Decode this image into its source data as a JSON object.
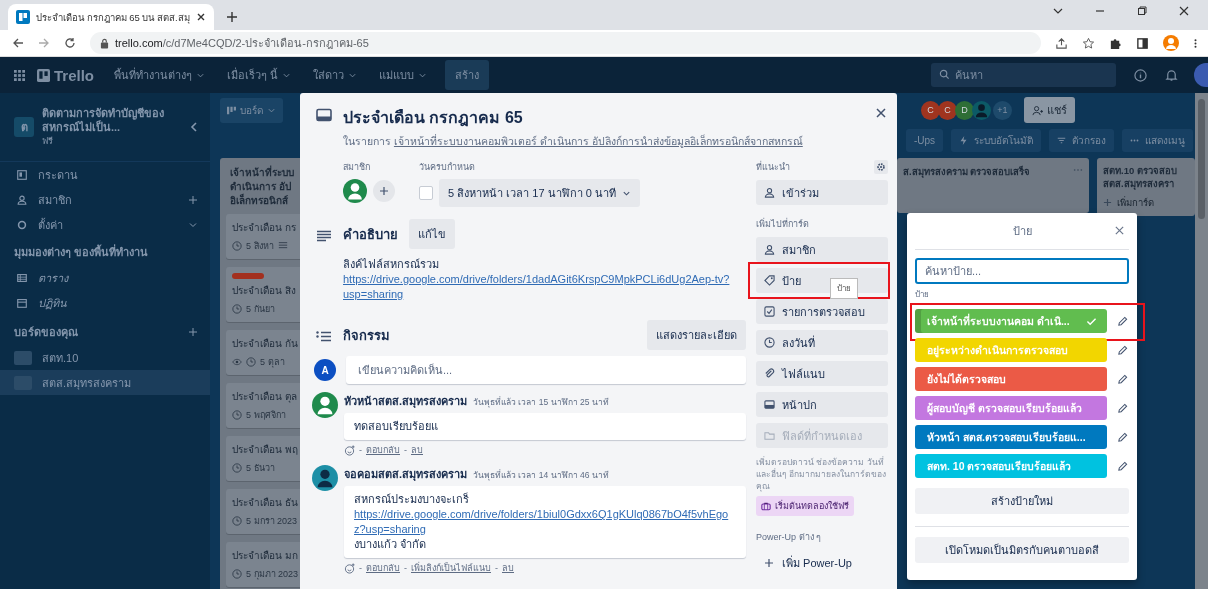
{
  "browser": {
    "tab_title": "ประจำเดือน กรกฎาคม 65 บน สตส.สมุ",
    "url_host": "trello.com",
    "url_path": "/c/d7Me4CQD/2-ประจำเดือน-กรกฎาคม-65"
  },
  "header": {
    "logo": "Trello",
    "menus": [
      "พื้นที่ทำงานต่างๆ",
      "เมื่อเร็วๆ นี้",
      "ใส่ดาว",
      "แม่แบบ"
    ],
    "create": "สร้าง",
    "search_placeholder": "ค้นหา"
  },
  "sidebar": {
    "workspace_letter": "ต",
    "workspace_name": "ติดตามการจัดทำบัญชีของสหกรณ์ไม่เป็น...",
    "plan": "ฟรี",
    "items": [
      "กระดาน",
      "สมาชิก",
      "ตั้งค่า"
    ],
    "views_heading": "มุมมองต่างๆ ของพื้นที่ทำงาน",
    "views": [
      "ตาราง",
      "ปฏิทิน"
    ],
    "boards_heading": "บอร์ดของคุณ",
    "boards": [
      {
        "name": "สตท.10",
        "selected": false
      },
      {
        "name": "สตส.สมุทรสงคราม",
        "selected": true
      }
    ]
  },
  "board": {
    "view_button": "บอร์ด",
    "members": [
      {
        "kind": "letter",
        "text": "C",
        "color": "#a0341f"
      },
      {
        "kind": "letter",
        "text": "C",
        "color": "#a0341f"
      },
      {
        "kind": "letter",
        "text": "D",
        "color": "#2e6e36"
      },
      {
        "kind": "silhouette",
        "color": "#0c5a66"
      }
    ],
    "more_members": "+1",
    "share": "แชร์",
    "toolbar": [
      "-Ups",
      "ระบบอัตโนมัติ",
      "ตัวกรอง",
      "แสดงเมนู"
    ],
    "left_list": {
      "title_lines": [
        "เจ้าหน้าที่ระบบ",
        "ดำเนินการ อัป",
        "อิเล็กทรอนิกส์"
      ],
      "cards": [
        {
          "title": "ประจำเดือน กร",
          "due": "5 สิงหา",
          "has_description": true,
          "watching": false
        },
        {
          "title": "ประจำเดือน สิง",
          "due": "5 กันยา",
          "labels": [
            {
              "color": "#a3301f"
            }
          ],
          "has_description": false,
          "watching": false
        },
        {
          "title": "ประจำเดือน กัน",
          "due": "5 ตุลา",
          "has_description": false,
          "watching": true
        },
        {
          "title": "ประจำเดือน ตุล",
          "due": "5 พฤศจิกา",
          "has_description": false,
          "watching": false
        },
        {
          "title": "ประจำเดือน พฤ",
          "due": "5 ธันวา",
          "has_description": false,
          "watching": false
        },
        {
          "title": "ประจำเดือน ธัน",
          "due": "5 มกรา 2023",
          "has_description": false,
          "watching": false
        },
        {
          "title": "ประจำเดือน มก",
          "due": "5 กุมภา 2023",
          "has_description": false,
          "watching": false
        }
      ]
    },
    "right_lists": [
      {
        "title": "ส.สมุทรสงคราม ตรวจสอบเสร็จ"
      },
      {
        "title_lines": [
          "สตท.10 ตรวจสอบ",
          "สตส.สมุทรสงครา"
        ],
        "add": "เพิ่มการ์ด"
      }
    ]
  },
  "modal": {
    "title": "ประจำเดือน กรกฎาคม 65",
    "in_list_prefix": "ในรายการ",
    "list_link": "เจ้าหน้าที่ระบบงานคอมพิวเตอร์ ดำเนินการ อัปลิงก์การนำส่งข้อมูลอิเล็กทรอนิกส์จากสหกรณ์",
    "members_label": "สมาชิก",
    "due_label": "วันครบกำหนด",
    "due_checked": false,
    "due_value": "5 สิงหาหน้า เวลา 17 นาฬิกา 0 นาที",
    "description_heading": "คำอธิบาย",
    "edit_button": "แก้ไข",
    "description_text": "ลิงค์ไฟล์สหกรณ์รวม",
    "description_link": "https://drive.google.com/drive/folders/1dadAGit6KrspC9MpkPCLi6dUg2Aep-tv?usp=sharing",
    "activity_heading": "กิจกรรม",
    "show_details": "แสดงรายละเอียด",
    "comment_avatar": "A",
    "comment_placeholder": "เขียนความคิดเห็น...",
    "comments": [
      {
        "author": "หัวหน้าสตส.สมุทรสงคราม",
        "time": "วันพุธที่แล้ว เวลา 15 นาฬิกา 25 นาที",
        "color": "#1f8a4c",
        "text": "ทดสอบเรียบร้อยแ",
        "separator": "-",
        "actions": [
          "ตอบกลับ",
          "ลบ"
        ]
      },
      {
        "author": "จอคอมสตส.สมุทรสงคราม",
        "time": "วันพุธที่แล้ว เวลา 14 นาฬิกา 46 นาที",
        "color": "#1d8fa6",
        "text": "สหกรณ์ประมงบางจะเกร็",
        "link": "https://drive.google.com/drive/folders/1biul0Gdxx6Q1gKUlq0867bO4f5vhEgoz?usp=sharing",
        "text_after": "งบางแก้ว จำกัด",
        "separator": "-",
        "actions": [
          "ตอบกลับ",
          "เพิ่มลิงก์เป็นไฟล์แนบ",
          "ลบ"
        ]
      }
    ],
    "suggested_heading": "ที่แนะนำ",
    "suggested": [
      "เข้าร่วม"
    ],
    "add_heading": "เพิ่มไปที่การ์ด",
    "actions": [
      {
        "label": "สมาชิก",
        "disabled": false,
        "highlighted": false
      },
      {
        "label": "ป้าย",
        "disabled": false,
        "highlighted": true,
        "tooltip": "ป้าย"
      },
      {
        "label": "รายการตรวจสอบ",
        "disabled": false,
        "highlighted": false
      },
      {
        "label": "ลงวันที่",
        "disabled": false,
        "highlighted": false
      },
      {
        "label": "ไฟล์แนบ",
        "disabled": false,
        "highlighted": false
      },
      {
        "label": "หน้าปก",
        "disabled": false,
        "highlighted": false
      },
      {
        "label": "ฟิลด์ที่กำหนดเอง",
        "disabled": true,
        "highlighted": false
      }
    ],
    "upsell_text": "เพิ่มดรอปดาวน์ ช่องข้อความ วันที่ และอื่นๆ อีกมากมายลงในการ์ดของคุณ",
    "trial_badge": "เริ่มต้นทดลองใช้ฟรี",
    "powerups_heading": "Power-Up ต่าง ๆ",
    "add_powerup": "เพิ่ม Power-Up"
  },
  "labels_popover": {
    "title": "ป้าย",
    "search_placeholder": "ค้นหาป้าย...",
    "section_label": "ป้าย",
    "labels": [
      {
        "text": "เจ้าหน้าที่ระบบงานคอม ดำเนิ...",
        "color": "#61bd4f",
        "selected": true,
        "highlighted": true
      },
      {
        "text": "อยู่ระหว่างดำเนินการตรวจสอบ",
        "color": "#f2d600",
        "selected": false,
        "highlighted": false
      },
      {
        "text": "ยังไม่ได้ตรวจสอบ",
        "color": "#eb5a46",
        "selected": false,
        "highlighted": false
      },
      {
        "text": "ผู้สอบบัญชี ตรวจสอบเรียบร้อยแล้ว",
        "color": "#c377e0",
        "selected": false,
        "highlighted": false
      },
      {
        "text": "หัวหน้า สตส.ตรวจสอบเรียบร้อยแ...",
        "color": "#0079bf",
        "selected": false,
        "highlighted": false
      },
      {
        "text": "สตท. 10 ตรวจสอบเรียบร้อยแล้ว",
        "color": "#00c2e0",
        "selected": false,
        "highlighted": false
      }
    ],
    "create_button": "สร้างป้ายใหม่",
    "colorblind_button": "เปิดโหมดเป็นมิตรกับคนตาบอดสี"
  }
}
